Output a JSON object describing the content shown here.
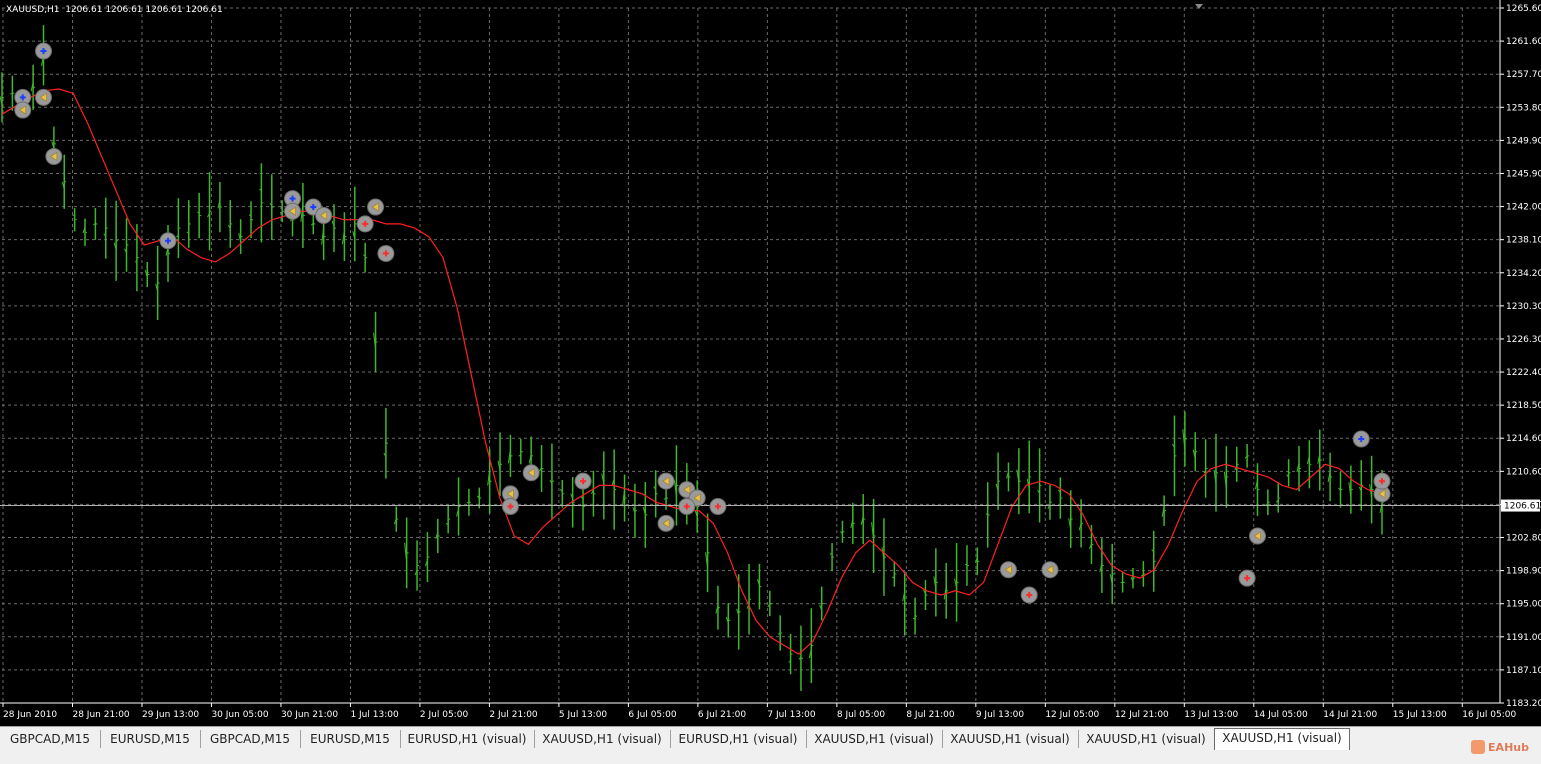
{
  "chart_header": {
    "symbol": "XAUUSD,H1",
    "quote": "1206.61 1206.61 1206.61 1206.61"
  },
  "price_axis": {
    "labels": [
      "1265.60",
      "1261.60",
      "1257.70",
      "1253.80",
      "1249.90",
      "1245.90",
      "1242.00",
      "1238.10",
      "1234.20",
      "1230.30",
      "1226.30",
      "1222.40",
      "1218.50",
      "1214.60",
      "1210.60",
      "1206.70",
      "1202.80",
      "1198.90",
      "1195.00",
      "1191.00",
      "1187.10",
      "1183.20"
    ],
    "current_price": "1206.61"
  },
  "time_axis": {
    "labels": [
      "28 Jun 2010",
      "28 Jun 21:00",
      "29 Jun 13:00",
      "30 Jun 05:00",
      "30 Jun 21:00",
      "1 Jul 13:00",
      "2 Jul 05:00",
      "2 Jul 21:00",
      "5 Jul 13:00",
      "6 Jul 05:00",
      "6 Jul 21:00",
      "7 Jul 13:00",
      "8 Jul 05:00",
      "8 Jul 21:00",
      "9 Jul 13:00",
      "12 Jul 05:00",
      "12 Jul 21:00",
      "13 Jul 13:00",
      "14 Jul 05:00",
      "14 Jul 21:00",
      "15 Jul 13:00",
      "16 Jul 05:00"
    ]
  },
  "chart_data": {
    "type": "line",
    "title": "XAUUSD,H1",
    "symbol": "XAUUSD",
    "timeframe": "H1",
    "ylim": [
      1183.2,
      1265.6
    ],
    "grid": true,
    "colors": {
      "background": "#000000",
      "bars": "#3fb72a",
      "ma": "#ff2020",
      "grid": "#6a6a6a",
      "axis": "#ffffff"
    },
    "series": [
      {
        "values": [
          1255.0,
          1255.5,
          1254.0,
          1256.2,
          1260.0,
          1249.5,
          1245.0,
          1240.5,
          1239.0,
          1240.0,
          1239.5,
          1238.0,
          1237.5,
          1236.0,
          1234.0,
          1233.0,
          1236.5,
          1239.5,
          1240.0,
          1241.0,
          1241.5,
          1242.0,
          1240.0,
          1238.5,
          1240.5,
          1242.5,
          1242.0,
          1241.5,
          1240.5,
          1241.0,
          1240.0,
          1238.5,
          1239.5,
          1238.5,
          1240.0,
          1236.0,
          1226.0,
          1214.0,
          1205.0,
          1201.0,
          1199.5,
          1200.5,
          1203.0,
          1205.0,
          1206.5,
          1207.0,
          1207.5,
          1209.5,
          1211.5,
          1212.5,
          1213.0,
          1212.5,
          1211.0,
          1209.5,
          1208.0,
          1207.0,
          1206.5,
          1208.0,
          1209.0,
          1208.5,
          1207.5,
          1206.0,
          1205.5,
          1208.0,
          1207.5,
          1209.0,
          1208.0,
          1206.5,
          1201.0,
          1194.5,
          1193.0,
          1194.0,
          1195.5,
          1197.0,
          1195.0,
          1191.5,
          1189.0,
          1188.5,
          1190.0,
          1195.0,
          1200.5,
          1203.5,
          1204.5,
          1205.0,
          1203.0,
          1200.5,
          1198.5,
          1195.0,
          1193.5,
          1196.0,
          1197.5,
          1196.5,
          1197.5,
          1199.5,
          1200.0,
          1205.5,
          1209.5,
          1210.0,
          1209.5,
          1210.0,
          1209.0,
          1207.0,
          1207.5,
          1205.0,
          1204.5,
          1202.0,
          1199.5,
          1198.5,
          1197.5,
          1198.0,
          1198.5,
          1200.0,
          1206.0,
          1212.5,
          1214.5,
          1213.0,
          1211.0,
          1210.5,
          1210.0,
          1211.5,
          1212.5,
          1208.5,
          1207.0,
          1207.5,
          1210.5,
          1211.0,
          1211.5,
          1212.0,
          1210.0,
          1208.5,
          1208.5,
          1209.0,
          1208.5,
          1207.0
        ]
      },
      {
        "values": [
          1253.0,
          1254.0,
          1255.0,
          1255.8,
          1256.0,
          1255.5,
          1252.0,
          1248.0,
          1244.0,
          1240.0,
          1237.5,
          1238.0,
          1238.5,
          1237.0,
          1236.0,
          1235.5,
          1236.5,
          1238.0,
          1239.5,
          1240.5,
          1241.0,
          1241.5,
          1241.5,
          1241.0,
          1240.5,
          1240.5,
          1240.5,
          1240.0,
          1240.0,
          1239.5,
          1238.5,
          1236.0,
          1230.0,
          1222.0,
          1214.0,
          1207.5,
          1203.0,
          1202.0,
          1204.0,
          1205.5,
          1207.0,
          1208.0,
          1209.0,
          1209.0,
          1208.5,
          1208.0,
          1207.0,
          1206.5,
          1206.0,
          1206.0,
          1204.5,
          1201.0,
          1196.5,
          1193.0,
          1191.0,
          1190.0,
          1189.0,
          1190.5,
          1194.0,
          1198.0,
          1201.0,
          1202.5,
          1201.0,
          1199.5,
          1197.5,
          1196.5,
          1196.0,
          1196.5,
          1196.0,
          1197.5,
          1202.0,
          1206.5,
          1209.0,
          1209.5,
          1209.0,
          1208.0,
          1205.5,
          1202.0,
          1199.5,
          1198.5,
          1198.0,
          1199.0,
          1202.0,
          1206.0,
          1209.5,
          1211.0,
          1211.5,
          1211.0,
          1210.5,
          1210.0,
          1209.0,
          1208.5,
          1210.0,
          1211.5,
          1211.0,
          1209.5,
          1208.5,
          1208.0
        ]
      }
    ],
    "markers": [
      {
        "type": "buy",
        "price": 1260.5,
        "bar": 4
      },
      {
        "type": "buy",
        "price": 1255.0,
        "bar": 2
      },
      {
        "type": "close",
        "price": 1253.5,
        "bar": 2
      },
      {
        "type": "close",
        "price": 1255.0,
        "bar": 4
      },
      {
        "type": "close",
        "price": 1248.0,
        "bar": 5
      },
      {
        "type": "buy",
        "price": 1238.0,
        "bar": 16
      },
      {
        "type": "buy",
        "price": 1243.0,
        "bar": 28
      },
      {
        "type": "buy",
        "price": 1242.0,
        "bar": 30
      },
      {
        "type": "close",
        "price": 1241.5,
        "bar": 28
      },
      {
        "type": "close",
        "price": 1241.0,
        "bar": 31
      },
      {
        "type": "sell",
        "price": 1240.0,
        "bar": 35
      },
      {
        "type": "close",
        "price": 1242.0,
        "bar": 36
      },
      {
        "type": "sell",
        "price": 1236.5,
        "bar": 37
      },
      {
        "type": "close",
        "price": 1208.0,
        "bar": 49
      },
      {
        "type": "close",
        "price": 1210.5,
        "bar": 51
      },
      {
        "type": "sell",
        "price": 1206.5,
        "bar": 49
      },
      {
        "type": "sell",
        "price": 1209.5,
        "bar": 56
      },
      {
        "type": "close",
        "price": 1209.5,
        "bar": 64
      },
      {
        "type": "close",
        "price": 1208.5,
        "bar": 66
      },
      {
        "type": "close",
        "price": 1207.5,
        "bar": 67
      },
      {
        "type": "sell",
        "price": 1206.5,
        "bar": 66
      },
      {
        "type": "close",
        "price": 1204.5,
        "bar": 64
      },
      {
        "type": "sell",
        "price": 1206.5,
        "bar": 69
      },
      {
        "type": "close",
        "price": 1199.0,
        "bar": 97
      },
      {
        "type": "sell",
        "price": 1196.0,
        "bar": 99
      },
      {
        "type": "close",
        "price": 1199.0,
        "bar": 101
      },
      {
        "type": "sell",
        "price": 1198.0,
        "bar": 120
      },
      {
        "type": "close",
        "price": 1203.0,
        "bar": 121
      },
      {
        "type": "buy",
        "price": 1214.5,
        "bar": 131
      },
      {
        "type": "close",
        "price": 1208.0,
        "bar": 134
      },
      {
        "type": "sell",
        "price": 1209.5,
        "bar": 145
      }
    ]
  },
  "tabs": [
    {
      "label": "GBPCAD,M15",
      "active": false
    },
    {
      "label": "EURUSD,M15",
      "active": false
    },
    {
      "label": "GBPCAD,M15",
      "active": false
    },
    {
      "label": "EURUSD,M15",
      "active": false
    },
    {
      "label": "EURUSD,H1 (visual)",
      "active": false
    },
    {
      "label": "XAUUSD,H1 (visual)",
      "active": false
    },
    {
      "label": "EURUSD,H1 (visual)",
      "active": false
    },
    {
      "label": "XAUUSD,H1 (visual)",
      "active": false
    },
    {
      "label": "XAUUSD,H1 (visual)",
      "active": false
    },
    {
      "label": "XAUUSD,H1 (visual)",
      "active": false
    },
    {
      "label": "XAUUSD,H1 (visual)",
      "active": true
    }
  ],
  "watermark": {
    "text": "EAHub"
  }
}
